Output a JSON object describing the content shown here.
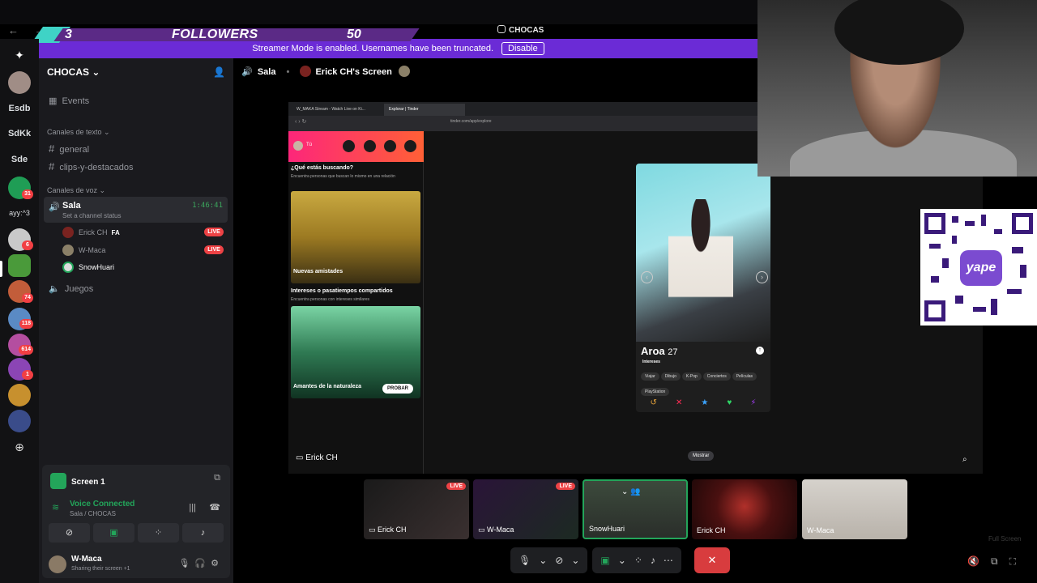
{
  "overlay": {
    "followers_count": "3",
    "followers_label": "FOLLOWERS",
    "followers_goal": "50"
  },
  "window": {
    "title": "CHOCAS"
  },
  "streamer_mode": {
    "message": "Streamer Mode is enabled. Usernames have been truncated.",
    "button": "Disable"
  },
  "rail": {
    "servers": [
      {
        "label": "Esdb"
      },
      {
        "label": "SdKk"
      },
      {
        "label": "Sde"
      },
      {
        "label": "ayy:^3"
      }
    ],
    "badges": [
      "31",
      "6",
      "74",
      "118",
      "614",
      "1"
    ]
  },
  "sidebar": {
    "server_name": "CHOCAS",
    "events": "Events",
    "text_category": "Canales de texto",
    "text_channels": [
      "general",
      "clips-y-destacados"
    ],
    "voice_category": "Canales de voz",
    "voice_channel": {
      "name": "Sala",
      "status": "Set a channel status",
      "time": "1:46:41"
    },
    "voice_users": [
      {
        "name": "Erick CH",
        "tag": "FA",
        "live": "LIVE"
      },
      {
        "name": "W-Maca",
        "live": "LIVE"
      },
      {
        "name": "SnowHuari"
      }
    ],
    "juegos": "Juegos"
  },
  "screen_panel": {
    "title": "Screen 1",
    "voice_connected": "Voice Connected",
    "voice_sub": "Sala / CHOCAS"
  },
  "user_panel": {
    "name": "W-Maca",
    "status": "Sharing their screen +1"
  },
  "stage": {
    "channel": "Sala",
    "screen_title": "Erick CH's Screen",
    "presenter": "Erick CH",
    "mostrar": "Mostrar"
  },
  "browser": {
    "tab1": "W_MAKA Stream - Watch Live on Ki...",
    "tab2": "Explorar | Tinder",
    "url": "tinder.com/app/explore"
  },
  "tinder": {
    "tu": "Tú",
    "question": "¿Qué estás buscando?",
    "question_sub": "Encuentra personas que buscan lo mismo en una relación",
    "card1": "Nuevas amistades",
    "section2": "Intereses o pasatiempos compartidos",
    "section2_sub": "Encuentra personas con intereses similares",
    "card2": "Amantes de la naturaleza",
    "probar": "PROBAR",
    "profile_name": "Aroa",
    "profile_age": "27",
    "interests_label": "Intereses",
    "interests": [
      "Viajar",
      "Dibujo",
      "K-Pop",
      "Conciertos",
      "Películas",
      "PlayStation"
    ]
  },
  "tiles": [
    {
      "name": "Erick CH",
      "live": "LIVE"
    },
    {
      "name": "W-Maca",
      "live": "LIVE"
    },
    {
      "name": "SnowHuari"
    },
    {
      "name": "Erick CH"
    },
    {
      "name": "W-Maca"
    }
  ],
  "fullscreen_hint": "Full Screen",
  "qr_logo": "yape",
  "colors": {
    "accent": "#6b2bd6",
    "live": "#ed4245",
    "connected": "#23a55a",
    "hangup": "#d83c3e",
    "tinder_gradient_start": "#fd267a",
    "tinder_gradient_end": "#ff6036"
  }
}
